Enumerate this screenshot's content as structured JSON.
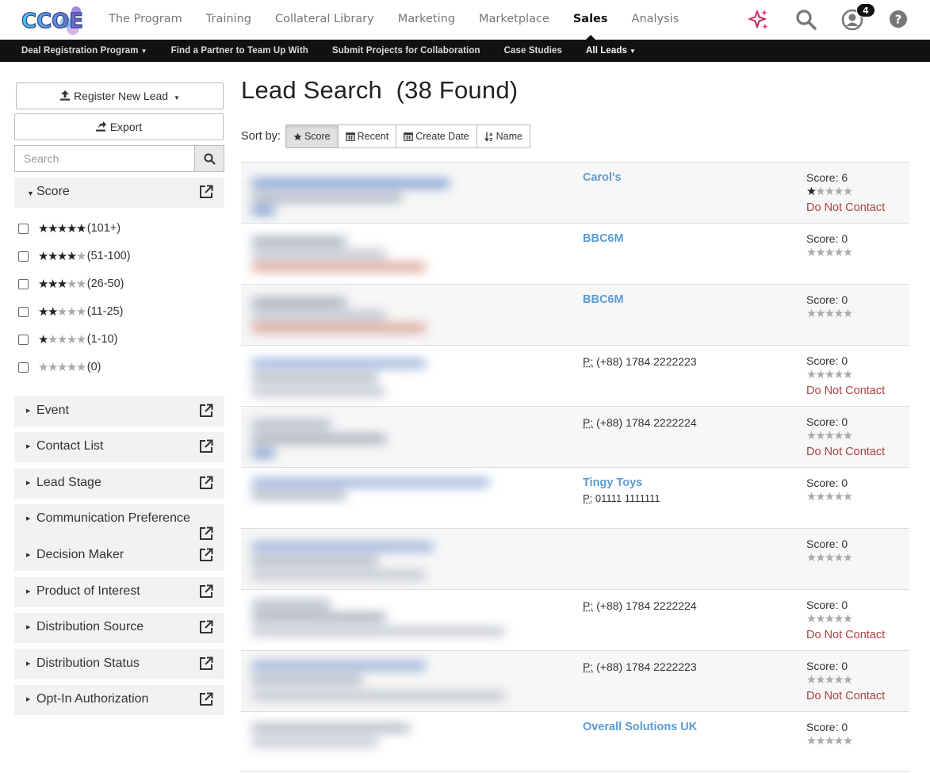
{
  "brand": {
    "logo_text": "CCOE"
  },
  "nav": {
    "items": [
      {
        "label": "The Program"
      },
      {
        "label": "Training"
      },
      {
        "label": "Collateral Library"
      },
      {
        "label": "Marketing"
      },
      {
        "label": "Marketplace"
      },
      {
        "label": "Sales"
      },
      {
        "label": "Analysis"
      }
    ],
    "active": "Sales",
    "notification_count": "4",
    "icons": [
      "sparkle-icon",
      "search-icon",
      "user-icon",
      "help-icon"
    ]
  },
  "subnav": {
    "items": [
      {
        "label": "Deal Registration Program",
        "dropdown": true
      },
      {
        "label": "Find a Partner to Team Up With",
        "dropdown": false
      },
      {
        "label": "Submit Projects for Collaboration",
        "dropdown": false
      },
      {
        "label": "Case Studies",
        "dropdown": false
      },
      {
        "label": "All Leads",
        "dropdown": true
      }
    ],
    "active": "All Leads"
  },
  "sidebar": {
    "register_label": "Register New Lead",
    "export_label": "Export",
    "search_placeholder": "Search",
    "score_facet": {
      "title": "Score",
      "options": [
        {
          "stars": 5,
          "range": "(101+)"
        },
        {
          "stars": 4,
          "range": "(51-100)"
        },
        {
          "stars": 3,
          "range": "(26-50)"
        },
        {
          "stars": 2,
          "range": "(11-25)"
        },
        {
          "stars": 1,
          "range": "(1-10)"
        },
        {
          "stars": 0,
          "range": "(0)"
        }
      ]
    },
    "facets": [
      "Event",
      "Contact List",
      "Lead Stage",
      "Communication Preference",
      "Decision Maker",
      "Product of Interest",
      "Distribution Source",
      "Distribution Status",
      "Opt-In Authorization"
    ]
  },
  "main": {
    "title": "Lead Search",
    "count_text": "(38 Found)",
    "sort_label": "Sort by:",
    "sort_options": [
      "Score",
      "Recent",
      "Create Date",
      "Name"
    ],
    "sort_active": "Score",
    "phone_prefix": "P:",
    "score_prefix": "Score:",
    "dnc_label": "Do Not Contact",
    "rows": [
      {
        "company": "Carol's",
        "phone": "",
        "score": "6",
        "stars": 1,
        "dnc": true
      },
      {
        "company": "BBC6M",
        "phone": "",
        "score": "0",
        "stars": 0,
        "dnc": false
      },
      {
        "company": "BBC6M",
        "phone": "",
        "score": "0",
        "stars": 0,
        "dnc": false
      },
      {
        "company": "",
        "phone": "(+88) 1784 2222223",
        "score": "0",
        "stars": 0,
        "dnc": true
      },
      {
        "company": "",
        "phone": "(+88) 1784 2222224",
        "score": "0",
        "stars": 0,
        "dnc": true
      },
      {
        "company": "Tingy Toys",
        "phone": "01111 1111111",
        "score": "0",
        "stars": 0,
        "dnc": false
      },
      {
        "company": "",
        "phone": "",
        "score": "0",
        "stars": 0,
        "dnc": false
      },
      {
        "company": "",
        "phone": "(+88) 1784 2222224",
        "score": "0",
        "stars": 0,
        "dnc": true
      },
      {
        "company": "",
        "phone": "(+88) 1784 2222223",
        "score": "0",
        "stars": 0,
        "dnc": true
      },
      {
        "company": "Overall Solutions UK",
        "phone": "",
        "score": "0",
        "stars": 0,
        "dnc": false
      }
    ]
  },
  "colors": {
    "link": "#5b9bd5",
    "danger": "#a94442",
    "subnav_bg": "#111111",
    "sparkle_from": "#e8336f",
    "sparkle_to": "#b3264f"
  }
}
